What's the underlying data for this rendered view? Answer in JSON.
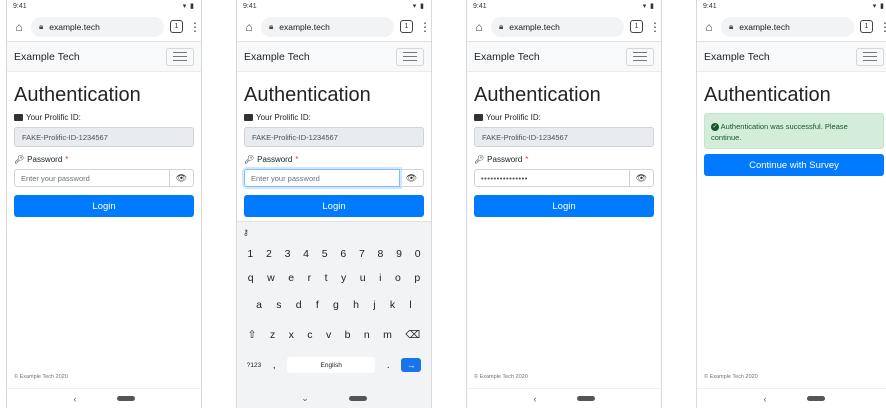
{
  "status": {
    "time": "9:41",
    "icons": "▾ ▮"
  },
  "browser": {
    "url": "example.tech",
    "tab_count": "1",
    "menu_icon": "⋮"
  },
  "site": {
    "brand": "Example Tech"
  },
  "page": {
    "title": "Authentication",
    "id_label": "Your Prolific ID:",
    "id_value": "FAKE-Prolific-ID-1234567",
    "password_label": "Password",
    "required_mark": "*",
    "password_placeholder": "Enter your password",
    "password_masked": "•••••••••••••••",
    "login_label": "Login",
    "success_message": "Authentication was successful. Please continue.",
    "continue_label": "Continue with Survey",
    "footer": "© Example Tech 2020"
  },
  "keyboard": {
    "top_icon": "key-icon",
    "row1": [
      "1",
      "2",
      "3",
      "4",
      "5",
      "6",
      "7",
      "8",
      "9",
      "0"
    ],
    "row2": [
      "q",
      "w",
      "e",
      "r",
      "t",
      "y",
      "u",
      "i",
      "o",
      "p"
    ],
    "row3": [
      "a",
      "s",
      "d",
      "f",
      "g",
      "h",
      "j",
      "k",
      "l"
    ],
    "row4": [
      "z",
      "x",
      "c",
      "v",
      "b",
      "n",
      "m"
    ],
    "symbols_label": "?123",
    "comma": ",",
    "space_label": "English",
    "period": "."
  },
  "colors": {
    "primary": "#007bff",
    "success_bg": "#d4edda",
    "success_text": "#155724",
    "required": "#dc3545"
  }
}
